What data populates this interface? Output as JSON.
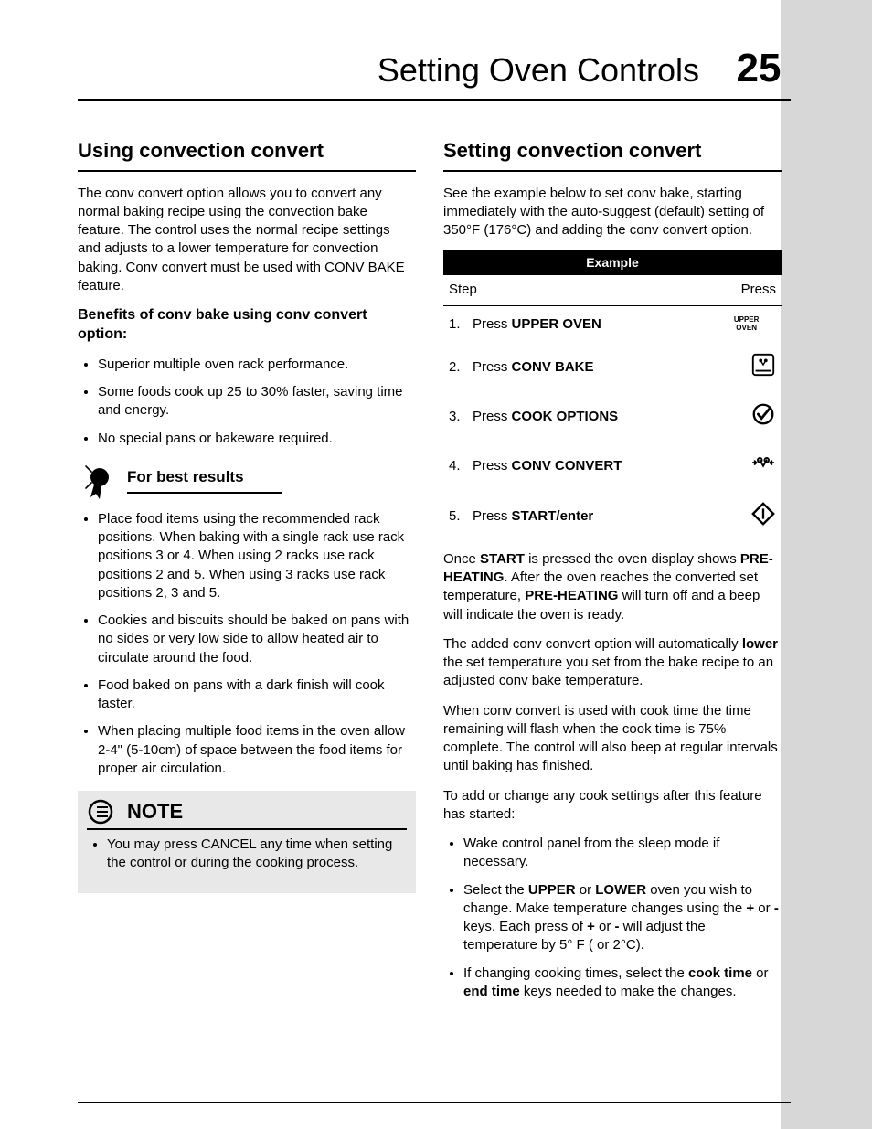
{
  "header": {
    "title": "Setting Oven Controls",
    "page": "25"
  },
  "left": {
    "h": "Using convection convert",
    "intro": "The  conv convert option allows you to convert any normal baking recipe using the convection bake feature. The control uses the normal recipe settings and adjusts to a lower temperature for convection baking. Conv convert must be used with CONV BAKE feature.",
    "sub": "Benefits of conv bake using conv convert option:",
    "benefits": [
      "Superior multiple oven rack performance.",
      "Some foods cook up 25 to 30% faster, saving time and energy.",
      "No special pans or bakeware required."
    ],
    "fb": "For best results",
    "tips": [
      "Place food items using the recommended rack positions. When baking with a single rack use rack positions 3 or 4. When using 2 racks use rack positions  2 and 5. When using 3 racks use rack positions 2, 3 and 5.",
      "Cookies and biscuits should be baked on pans with no sides or very low side to allow heated air to circulate around the food.",
      "Food baked on pans with a dark finish will cook faster.",
      "When placing multiple food items in the oven allow 2-4\" (5-10cm) of space between the food items for proper air circulation."
    ],
    "note": {
      "label": "NOTE",
      "text": "You may press CANCEL any time when setting the control or during the cooking process."
    }
  },
  "right": {
    "h": "Setting convection convert",
    "intro": "See the example below to set conv bake, starting immediately with the auto-suggest (default) setting of 350°F (176°C) and adding the conv convert option.",
    "table": {
      "bar": "Example",
      "c1": "Step",
      "c2": "Press",
      "rows": [
        {
          "n": "1.",
          "a": "Press ",
          "b": "UPPER OVEN",
          "icon": "upper-oven"
        },
        {
          "n": "2.",
          "a": "Press ",
          "b": "CONV BAKE",
          "icon": "conv-bake"
        },
        {
          "n": "3.",
          "a": "Press ",
          "b": "COOK OPTIONS",
          "icon": "cook-options"
        },
        {
          "n": "4.",
          "a": "Press ",
          "b": "CONV CONVERT",
          "icon": "conv-convert"
        },
        {
          "n": "5.",
          "a": "Press ",
          "b": "START/enter",
          "icon": "start"
        }
      ]
    },
    "p1": {
      "t1": "Once ",
      "b1": "START",
      "t2": " is pressed the oven display shows ",
      "b2": "PRE-HEATING",
      "t3": ". After the oven reaches the converted set temperature, ",
      "b3": "PRE-HEATING",
      "t4": " will turn off and a beep will indicate the oven is ready."
    },
    "p2": {
      "t1": "The added conv convert option will automatically ",
      "b1": "lower",
      "t2": " the set temperature you set from the bake recipe to an adjusted conv bake temperature."
    },
    "p3": "When conv convert is used with cook time the time remaining will flash when the cook time is 75% complete. The control will also beep at regular intervals until baking has finished.",
    "p4": "To add or change any cook settings after this feature has started:",
    "list": [
      {
        "t": "Wake control panel from the sleep mode if necessary."
      },
      {
        "t1": "Select the ",
        "b1": "UPPER",
        "t2": " or ",
        "b2": "LOWER",
        "t3": " oven you wish to change. Make temperature changes using the ",
        "b3": "+",
        "t4": " or ",
        "b4": "-",
        "t5": " keys. Each press of ",
        "b5": "+",
        "t6": " or ",
        "b6": "-",
        "t7": " will adjust the temperature by 5° F ( or 2°C)."
      },
      {
        "t1": "If changing cooking times, select the ",
        "b1": "cook time",
        "t2": " or ",
        "b2": "end time",
        "t3": " keys needed to make the changes."
      }
    ]
  }
}
